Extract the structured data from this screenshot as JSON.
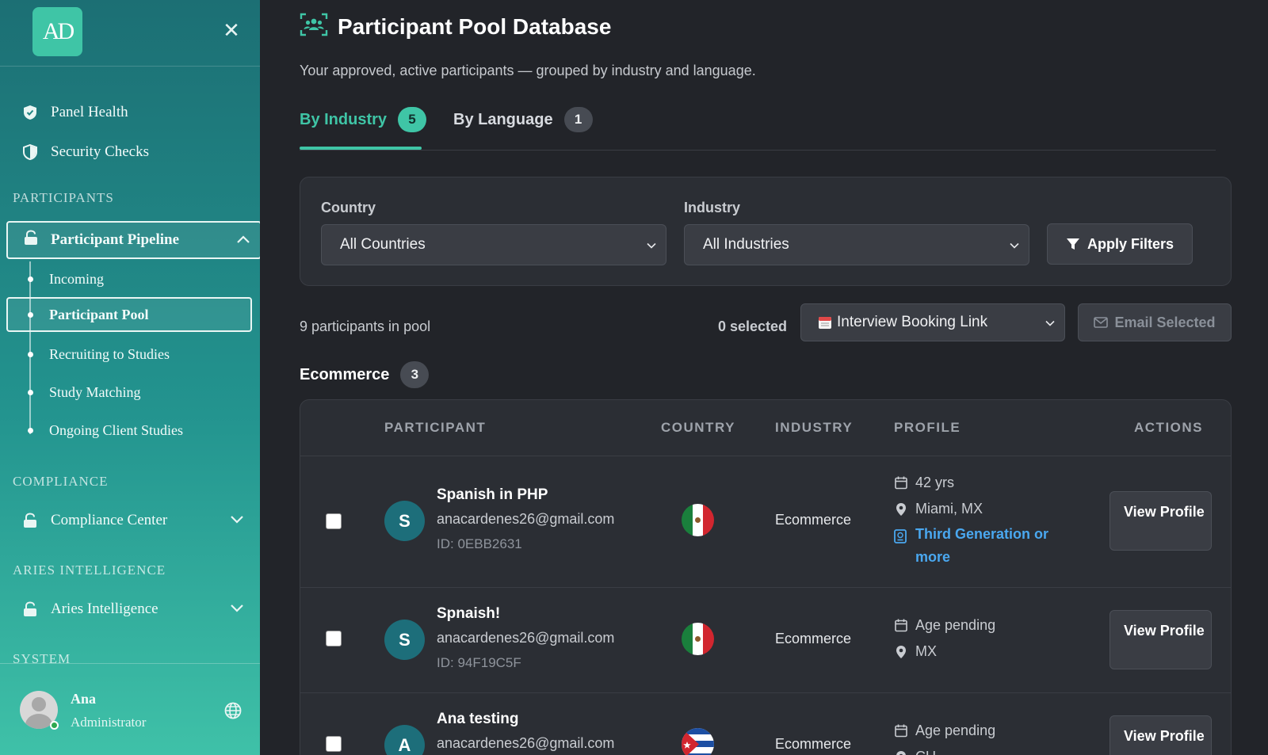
{
  "sidebar": {
    "logo_text": "AD",
    "items": [
      {
        "label": "Panel Health"
      },
      {
        "label": "Security Checks"
      }
    ],
    "sections": {
      "participants": "PARTICIPANTS",
      "compliance": "COMPLIANCE",
      "aries": "ARIES INTELLIGENCE",
      "system": "SYSTEM"
    },
    "pipeline": {
      "label": "Participant Pipeline",
      "subitems": [
        {
          "label": "Incoming"
        },
        {
          "label": "Participant Pool"
        },
        {
          "label": "Recruiting to Studies"
        },
        {
          "label": "Study Matching"
        },
        {
          "label": "Ongoing Client Studies"
        }
      ]
    },
    "compliance_center": "Compliance Center",
    "aries_intelligence": "Aries Intelligence",
    "user": {
      "name": "Ana",
      "role": "Administrator"
    }
  },
  "header": {
    "title": "Participant Pool Database",
    "subtitle": "Your approved, active participants — grouped by industry and language."
  },
  "tabs": [
    {
      "label": "By Industry",
      "count": "5"
    },
    {
      "label": "By Language",
      "count": "1"
    }
  ],
  "filters": {
    "country_label": "Country",
    "country_value": "All Countries",
    "industry_label": "Industry",
    "industry_value": "All Industries",
    "apply_label": "Apply Filters"
  },
  "toolbar": {
    "count_text": "9 participants in pool",
    "selected_text": "0 selected",
    "template_value": "Interview Booking Link",
    "email_label": "Email Selected"
  },
  "group": {
    "title": "Ecommerce",
    "count": "3"
  },
  "table": {
    "headers": {
      "participant": "PARTICIPANT",
      "country": "COUNTRY",
      "industry": "INDUSTRY",
      "profile": "PROFILE",
      "actions": "ACTIONS"
    },
    "rows": [
      {
        "initial": "S",
        "name": "Spanish in PHP",
        "email": "anacardenes26@gmail.com",
        "id": "ID: 0EBB2631",
        "country_flag": "mexico-flag",
        "industry": "Ecommerce",
        "age": "42 yrs",
        "location": "Miami, MX",
        "generation": "Third Generation or more",
        "action": "View Profile"
      },
      {
        "initial": "S",
        "name": "Spnaish!",
        "email": "anacardenes26@gmail.com",
        "id": "ID: 94F19C5F",
        "country_flag": "mexico-flag",
        "industry": "Ecommerce",
        "age": "Age pending",
        "location": "MX",
        "action": "View Profile"
      },
      {
        "initial": "A",
        "name": "Ana testing",
        "email": "anacardenes26@gmail.com",
        "country_flag": "cuba-flag",
        "industry": "Ecommerce",
        "age": "Age pending",
        "location": "CU",
        "action": "View Profile"
      }
    ]
  },
  "colors": {
    "accent": "#3fc5a6",
    "sidebar_top": "#1c6f74",
    "sidebar_bottom": "#3fc1a8",
    "link_blue": "#4aa8f0",
    "background": "#222429"
  }
}
